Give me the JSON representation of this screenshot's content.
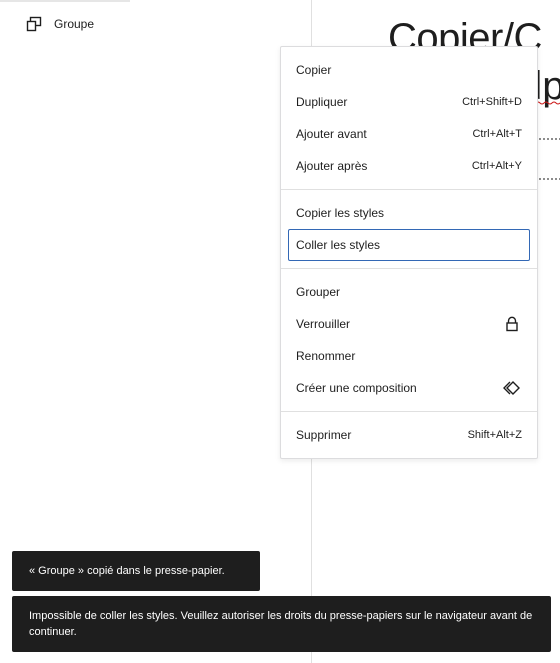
{
  "sidebar": {
    "item_label": "Groupe",
    "item_icon": "group-icon"
  },
  "canvas": {
    "title_line1": "Copier/C",
    "title_line2": "dp"
  },
  "menu": {
    "groups": [
      {
        "items": [
          {
            "label": "Copier",
            "shortcut": ""
          },
          {
            "label": "Dupliquer",
            "shortcut": "Ctrl+Shift+D"
          },
          {
            "label": "Ajouter avant",
            "shortcut": "Ctrl+Alt+T"
          },
          {
            "label": "Ajouter après",
            "shortcut": "Ctrl+Alt+Y"
          }
        ]
      },
      {
        "items": [
          {
            "label": "Copier les styles",
            "shortcut": ""
          },
          {
            "label": "Coller les styles",
            "shortcut": "",
            "focused": true
          }
        ]
      },
      {
        "items": [
          {
            "label": "Grouper",
            "shortcut": ""
          },
          {
            "label": "Verrouiller",
            "icon": "lock-icon"
          },
          {
            "label": "Renommer",
            "shortcut": ""
          },
          {
            "label": "Créer une composition",
            "icon": "pattern-symbol-icon"
          }
        ]
      },
      {
        "items": [
          {
            "label": "Supprimer",
            "shortcut": "Shift+Alt+Z"
          }
        ]
      }
    ]
  },
  "notices": {
    "copied": "« Groupe » copié dans le presse-papier.",
    "error": "Impossible de coller les styles. Veuillez autoriser les droits du presse-papiers sur le navigateur avant de continuer."
  },
  "colors": {
    "focus_ring": "#3368b5",
    "snackbar_bg": "#1e1e1e",
    "spelling_underline": "#cc1818"
  }
}
